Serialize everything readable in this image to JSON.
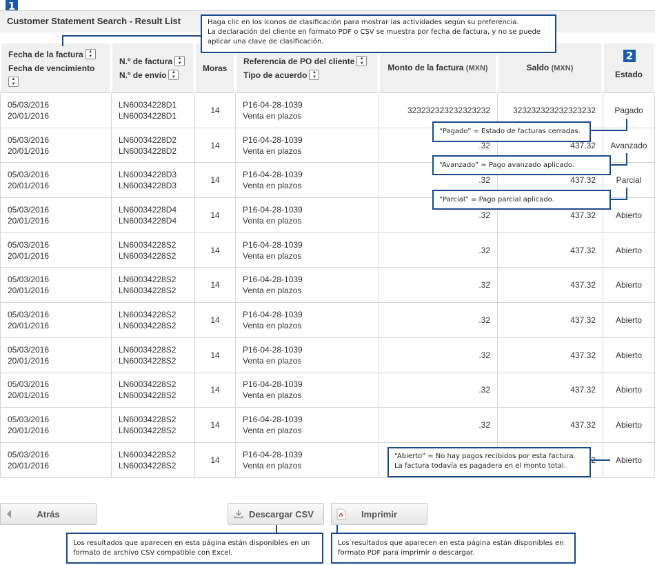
{
  "markers": {
    "m1": "1",
    "m2": "2"
  },
  "page_title": "Customer Statement Search - Result List",
  "table": {
    "headers": {
      "invoice_date": "Fecha de la factura",
      "due_date": "Fecha de vencimiento",
      "invoice_no": "N.º de factura",
      "shipment_no": "N.º de envío",
      "late": "Moras",
      "po_reference": "Referencia de PO del cliente",
      "agreement_type": "Tipo de acuerdo",
      "invoice_amount": "Monto de la factura",
      "balance": "Saldo",
      "currency": "(MXN)",
      "status": "Estado"
    },
    "rows": [
      {
        "invoice_date": "05/03/2016",
        "due_date": "20/01/2016",
        "invoice_no": "LN60034228D1",
        "shipment_no": "LN60034228D1",
        "late": "14",
        "po": "P16-04-28-1039",
        "agreement": "Venta en plazos",
        "amount": "323232323232323232",
        "balance": "323232323232323232",
        "status": "Pagado"
      },
      {
        "invoice_date": "05/03/2016",
        "due_date": "20/01/2016",
        "invoice_no": "LN60034228D2",
        "shipment_no": "LN60034228D2",
        "late": "14",
        "po": "P16-04-28-1039",
        "agreement": "Venta en plazos",
        "amount": ".32",
        "balance": "437.32",
        "status": "Avanzado"
      },
      {
        "invoice_date": "05/03/2016",
        "due_date": "20/01/2016",
        "invoice_no": "LN60034228D3",
        "shipment_no": "LN60034228D3",
        "late": "14",
        "po": "P16-04-28-1039",
        "agreement": "Venta en plazos",
        "amount": ".32",
        "balance": "437.32",
        "status": "Parcial"
      },
      {
        "invoice_date": "05/03/2016",
        "due_date": "20/01/2016",
        "invoice_no": "LN60034228D4",
        "shipment_no": "LN60034228D4",
        "late": "14",
        "po": "P16-04-28-1039",
        "agreement": "Venta en plazos",
        "amount": ".32",
        "balance": "437.32",
        "status": "Abierto"
      },
      {
        "invoice_date": "05/03/2016",
        "due_date": "20/01/2016",
        "invoice_no": "LN60034228S2",
        "shipment_no": "LN60034228S2",
        "late": "14",
        "po": "P16-04-28-1039",
        "agreement": "Venta en plazos",
        "amount": ".32",
        "balance": "437.32",
        "status": "Abierto"
      },
      {
        "invoice_date": "05/03/2016",
        "due_date": "20/01/2016",
        "invoice_no": "LN60034228S2",
        "shipment_no": "LN60034228S2",
        "late": "14",
        "po": "P16-04-28-1039",
        "agreement": "Venta en plazos",
        "amount": ".32",
        "balance": "437.32",
        "status": "Abierto"
      },
      {
        "invoice_date": "05/03/2016",
        "due_date": "20/01/2016",
        "invoice_no": "LN60034228S2",
        "shipment_no": "LN60034228S2",
        "late": "14",
        "po": "P16-04-28-1039",
        "agreement": "Venta en plazos",
        "amount": ".32",
        "balance": "437.32",
        "status": "Abierto"
      },
      {
        "invoice_date": "05/03/2016",
        "due_date": "20/01/2016",
        "invoice_no": "LN60034228S2",
        "shipment_no": "LN60034228S2",
        "late": "14",
        "po": "P16-04-28-1039",
        "agreement": "Venta en plazos",
        "amount": ".32",
        "balance": "437.32",
        "status": "Abierto"
      },
      {
        "invoice_date": "05/03/2016",
        "due_date": "20/01/2016",
        "invoice_no": "LN60034228S2",
        "shipment_no": "LN60034228S2",
        "late": "14",
        "po": "P16-04-28-1039",
        "agreement": "Venta en plazos",
        "amount": ".32",
        "balance": "437.32",
        "status": "Abierto"
      },
      {
        "invoice_date": "05/03/2016",
        "due_date": "20/01/2016",
        "invoice_no": "LN60034228S2",
        "shipment_no": "LN60034228S2",
        "late": "14",
        "po": "P16-04-28-1039",
        "agreement": "Venta en plazos",
        "amount": ".32",
        "balance": "437.32",
        "status": "Abierto"
      },
      {
        "invoice_date": "05/03/2016",
        "due_date": "20/01/2016",
        "invoice_no": "LN60034228S2",
        "shipment_no": "LN60034228S2",
        "late": "14",
        "po": "P16-04-28-1039",
        "agreement": "Venta en plazos",
        "amount": "",
        "balance": "2",
        "status": "Abierto"
      }
    ]
  },
  "notes": {
    "sort_line1": "Haga clic en los íconos de clasificación para mostrar las actividades según su preferencia.",
    "sort_line2": "La declaración del cliente en formato PDF o CSV se muestra por fecha de factura, y no se puede",
    "sort_line3": "aplicar una clave de clasificación.",
    "pagado": "“Pagado” = Estado de facturas cerradas.",
    "avanzado": "“Avanzado” = Pago avanzado aplicado.",
    "parcial": "“Parcial” = Pago parcial aplicado.",
    "abierto_line1": "“Abierto” = No hay pagos recibidos por esta factura.",
    "abierto_line2": "La factura todavía es pagadera en el monto total.",
    "csv_line1": "Los resultados que aparecen en esta página están disponibles en un",
    "csv_line2": "formato de archivo CSV compatible con Excel.",
    "pdf_line1": "Los resultados que aparecen en esta página están disponibles en",
    "pdf_line2": "formato PDF para imprimir o descargar."
  },
  "buttons": {
    "back": "Atrás",
    "csv": "Descargar CSV",
    "print": "Imprimir"
  },
  "colors": {
    "accent": "#1a4a8c",
    "marker": "#1a5ca8",
    "header_bg": "#f0f0f0"
  }
}
